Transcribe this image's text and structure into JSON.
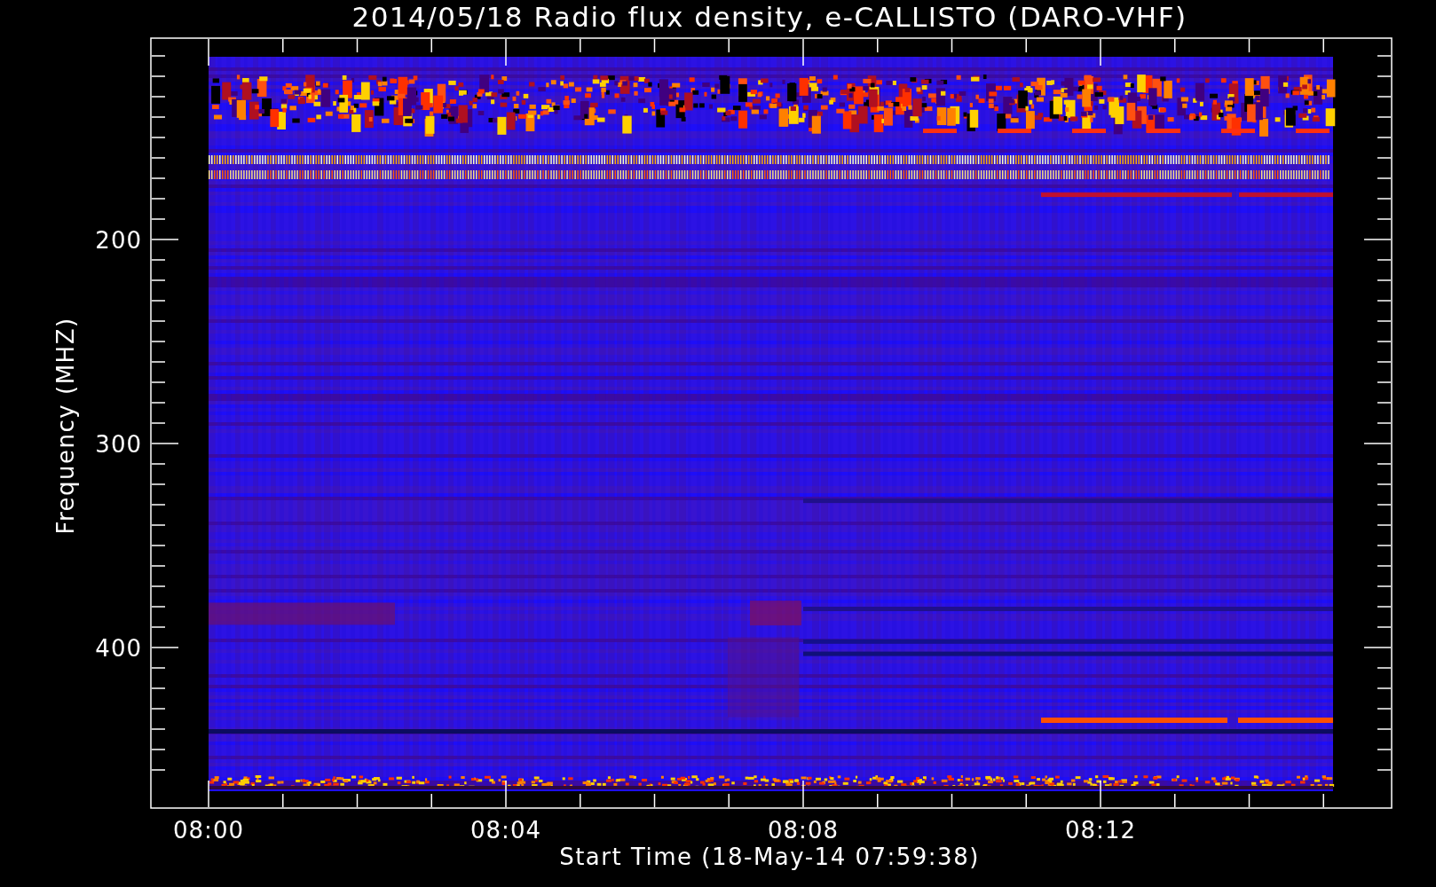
{
  "title": "2014/05/18  Radio flux density, e-CALLISTO (DARO-VHF)",
  "y_axis": {
    "label": "Frequency (MHZ)",
    "tick_labels": [
      "200",
      "300",
      "400"
    ]
  },
  "x_axis": {
    "label": "Start Time (18-May-14 07:59:38)",
    "tick_labels": [
      "08:00",
      "08:04",
      "08:08",
      "08:12"
    ]
  }
}
